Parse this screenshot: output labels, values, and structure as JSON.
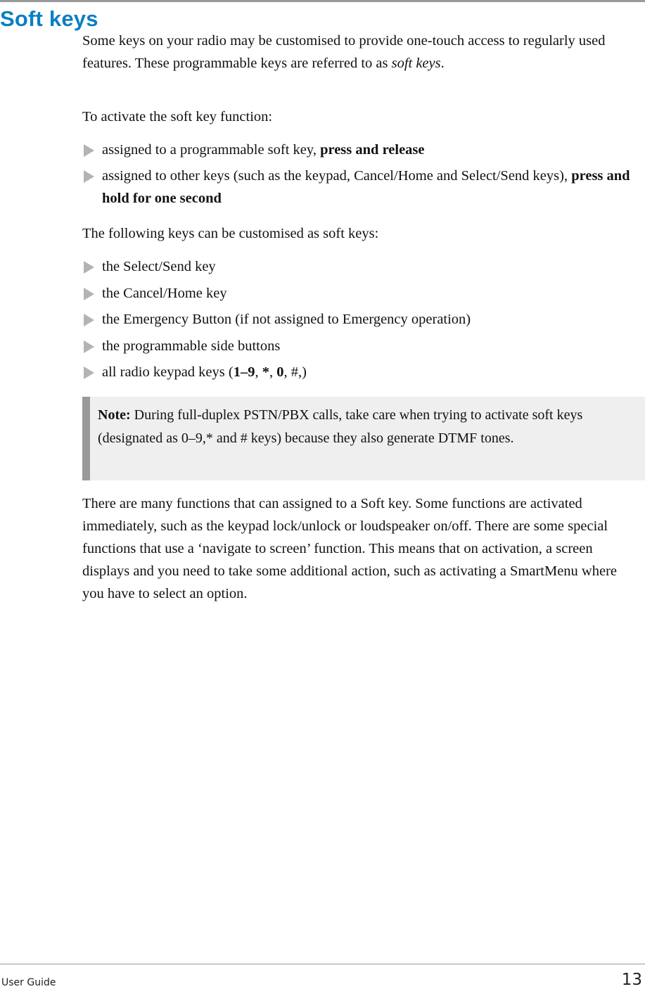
{
  "heading": "Soft keys",
  "intro": {
    "text": "Some keys on your radio may be customised to provide one-touch access to regularly used features. These programmable keys are referred to as ",
    "emphasis": "soft keys",
    "end": "."
  },
  "activate_label": "To activate the soft key function:",
  "activate_bullets": [
    {
      "text": "assigned to a programmable soft key, ",
      "bold": "press and release"
    },
    {
      "text": "assigned to other keys (such as the keypad, Cancel/Home and Select/Send keys), ",
      "bold": "press and hold for one second"
    }
  ],
  "customisable_label": "The following keys can be customised as soft keys:",
  "customisable_bullets": [
    "the Select/Send key",
    "the Cancel/Home key",
    "the Emergency Button (if not assigned to Emergency operation)",
    "the programmable side buttons"
  ],
  "keypad_bullet": {
    "prefix": "all radio keypad keys (",
    "k1": "1–9",
    "sep1": ", ",
    "k2": "*",
    "sep2": ", ",
    "k3": "0",
    "sep3": ", ",
    "k4": "#",
    "suffix": ",)"
  },
  "note": {
    "label": "Note:",
    "text": " During full-duplex PSTN/PBX calls, take care when trying to activate soft keys (designated as 0–9,* and # keys) because they also generate DTMF tones."
  },
  "closing_paragraph": "There are many functions that can assigned to a Soft key. Some functions are activated immediately, such as the keypad lock/unlock or loudspeaker on/off. There are some special functions that use a ‘navigate to screen’ function. This means that on activation, a screen displays and you need to take some additional action, such as activating a SmartMenu where you have to select an option.",
  "footer": {
    "document": "User Guide",
    "page_number": "13"
  }
}
